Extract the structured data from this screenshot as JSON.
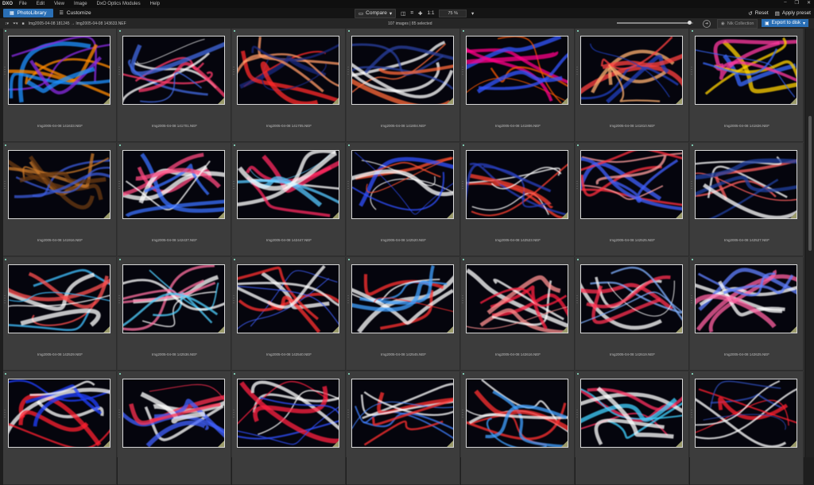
{
  "app": {
    "logo": "DXO",
    "menu": [
      "File",
      "Edit",
      "View",
      "Image",
      "DxO Optics Modules",
      "Help"
    ],
    "window_controls": [
      "–",
      "❐",
      "✕"
    ]
  },
  "toolbar": {
    "tabs": [
      {
        "label": "PhotoLibrary",
        "icon": "grid-icon",
        "active": true
      },
      {
        "label": "Customize",
        "icon": "sliders-icon",
        "active": false
      }
    ],
    "compare_label": "Compare",
    "zoom_ratio": "1:1",
    "zoom_value": "75 %",
    "reset_label": "Reset",
    "apply_preset_label": "Apply preset"
  },
  "browser": {
    "breadcrumb": "Img2005-04-08 181245 → Img2005-04-08 143633.NEF",
    "count": "107 images | 85 selected",
    "thumb_size": 0.95,
    "nik_label": "Nik Collection",
    "export_label": "Export to disk"
  },
  "colors": {
    "accent": "#2a6fb5",
    "panel": "#3c3c3c"
  },
  "thumbnails": [
    {
      "name": "Img2005-04-08 141633.NEF",
      "palette": [
        "#ff8a00",
        "#8a2be2",
        "#1e90ff"
      ]
    },
    {
      "name": "Img2005-04-08 141701.NEF",
      "palette": [
        "#ff3b6b",
        "#ffffff",
        "#4169e1"
      ]
    },
    {
      "name": "Img2005-04-08 141705.NEF",
      "palette": [
        "#ff2a2a",
        "#ff9966",
        "#1a2a80"
      ]
    },
    {
      "name": "Img2005-04-08 141804.NEF",
      "palette": [
        "#ff6a3a",
        "#ffffff",
        "#2a40a0"
      ]
    },
    {
      "name": "Img2005-04-08 141806.NEF",
      "palette": [
        "#ff5a00",
        "#ff0088",
        "#3355ff"
      ]
    },
    {
      "name": "Img2005-04-08 141810.NEF",
      "palette": [
        "#ff4040",
        "#ffb070",
        "#2040c0"
      ]
    },
    {
      "name": "Img2005-04-08 141826.NEF",
      "palette": [
        "#ffd000",
        "#ff3aa0",
        "#3a6aff"
      ]
    },
    {
      "name": "Img2005-04-08 141916.NEF",
      "palette": [
        "#c8782a",
        "#6a3a12",
        "#3b5bd9"
      ]
    },
    {
      "name": "Img2005-04-08 142437.NEF",
      "palette": [
        "#ff4a80",
        "#ffffff",
        "#3a70ff"
      ]
    },
    {
      "name": "Img2005-04-08 142447.NEF",
      "palette": [
        "#ff2a60",
        "#55c8ff",
        "#ffffff"
      ]
    },
    {
      "name": "Img2005-04-08 142520.NEF",
      "palette": [
        "#ff5030",
        "#ffffff",
        "#3050ff"
      ]
    },
    {
      "name": "Img2005-04-08 142523.NEF",
      "palette": [
        "#ff4030",
        "#ffffff",
        "#2a40c0"
      ]
    },
    {
      "name": "Img2005-04-08 142525.NEF",
      "palette": [
        "#ff3040",
        "#ffa0a0",
        "#4060ff"
      ]
    },
    {
      "name": "Img2005-04-08 142527.NEF",
      "palette": [
        "#ff6060",
        "#ffffff",
        "#2040a0"
      ]
    },
    {
      "name": "Img2005-04-08 142529.NEF",
      "palette": [
        "#ff5050",
        "#40c0ff",
        "#ffffff"
      ]
    },
    {
      "name": "Img2005-04-08 142536.NEF",
      "palette": [
        "#ffffff",
        "#ff70a0",
        "#50d0ff"
      ]
    },
    {
      "name": "Img2005-04-08 142540.NEF",
      "palette": [
        "#4060ff",
        "#ff3030",
        "#ffffff"
      ]
    },
    {
      "name": "Img2005-04-08 142545.NEF",
      "palette": [
        "#ffffff",
        "#ff3030",
        "#40a0ff"
      ]
    },
    {
      "name": "Img2005-04-08 142616.NEF",
      "palette": [
        "#ffffff",
        "#ff2040",
        "#ff9090"
      ]
    },
    {
      "name": "Img2005-04-08 142619.NEF",
      "palette": [
        "#ffffff",
        "#ff3050",
        "#80b0ff"
      ]
    },
    {
      "name": "Img2005-04-08 142625.NEF",
      "palette": [
        "#ffffff",
        "#ff60a0",
        "#6080ff"
      ]
    },
    {
      "name": "",
      "palette": [
        "#ffffff",
        "#ff2030",
        "#2040ff"
      ]
    },
    {
      "name": "",
      "palette": [
        "#ffffff",
        "#ff3050",
        "#4060ff"
      ]
    },
    {
      "name": "",
      "palette": [
        "#ffffff",
        "#ff2040",
        "#3050ff"
      ]
    },
    {
      "name": "",
      "palette": [
        "#ffffff",
        "#4080ff",
        "#ff3030"
      ]
    },
    {
      "name": "",
      "palette": [
        "#ff3030",
        "#ffffff",
        "#40a0ff"
      ]
    },
    {
      "name": "",
      "palette": [
        "#ff3060",
        "#40d0ff",
        "#ffffff"
      ]
    },
    {
      "name": "",
      "palette": [
        "#ff2030",
        "#ffffff",
        "#3050c0"
      ]
    }
  ]
}
